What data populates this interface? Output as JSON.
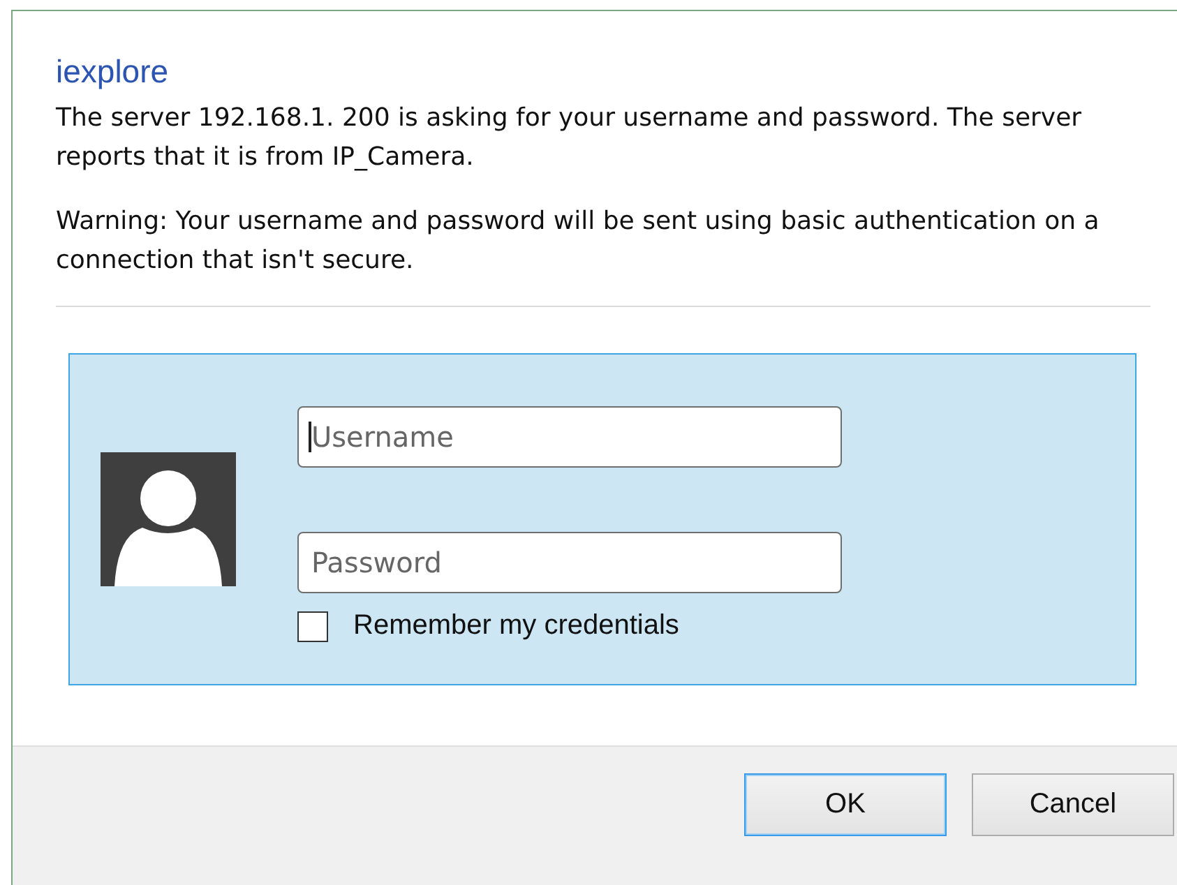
{
  "dialog": {
    "title": "iexplore",
    "message": "The server 192.168.1. 200 is asking for your username and password. The server reports that it is from IP_Camera.",
    "warning": "Warning: Your username and password will be sent using basic authentication on a connection that isn't secure."
  },
  "credentials": {
    "username": {
      "placeholder": "Username",
      "focused": true
    },
    "password": {
      "placeholder": "Password",
      "focused": false
    },
    "remember": {
      "label": "Remember my credentials",
      "checked": false
    }
  },
  "buttons": [
    {
      "label": "OK",
      "default": true
    },
    {
      "label": "Cancel",
      "default": false
    }
  ]
}
